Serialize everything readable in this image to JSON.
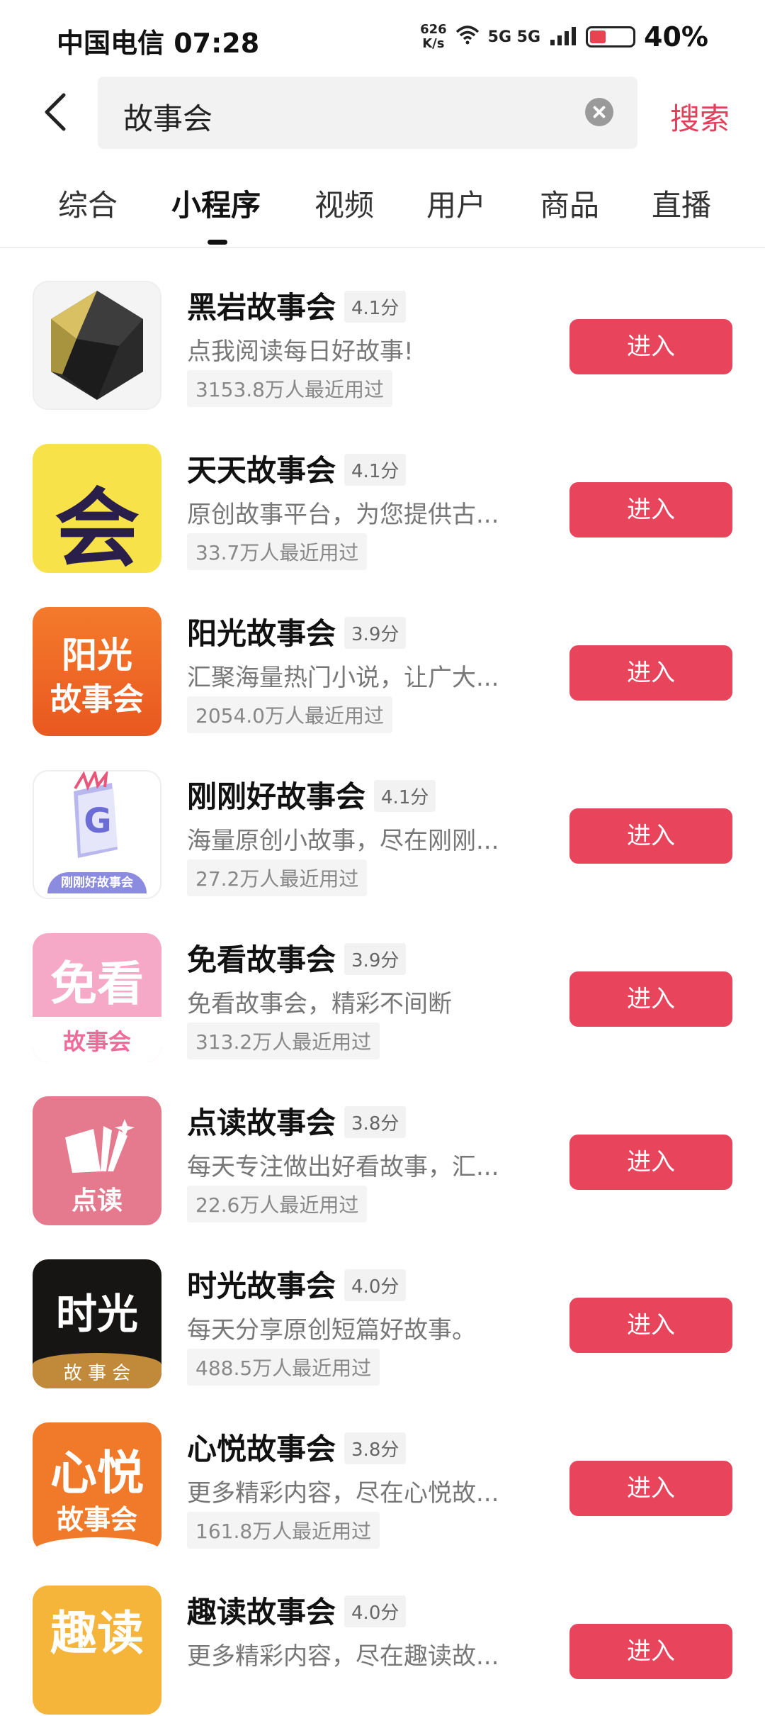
{
  "status": {
    "carrier_time": "中国电信 07:28",
    "net_speed": "626\nK/s",
    "signal": "5G 5G",
    "battery_level": 0.4,
    "battery_text": "40%"
  },
  "search": {
    "query": "故事会",
    "submit_label": "搜索"
  },
  "tabs": [
    {
      "label": "综合"
    },
    {
      "label": "小程序"
    },
    {
      "label": "视频"
    },
    {
      "label": "用户"
    },
    {
      "label": "商品"
    },
    {
      "label": "直播"
    }
  ],
  "active_tab": "小程序",
  "results": [
    {
      "name": "黑岩故事会",
      "score": "4.1分",
      "desc": "点我阅读每日好故事!",
      "users": "3153.8万人最近用过",
      "button": "进入"
    },
    {
      "name": "天天故事会",
      "score": "4.1分",
      "desc": "原创故事平台，为您提供古...",
      "users": "33.7万人最近用过",
      "button": "进入",
      "icon_text": "会"
    },
    {
      "name": "阳光故事会",
      "score": "3.9分",
      "desc": "汇聚海量热门小说，让广大...",
      "users": "2054.0万人最近用过",
      "button": "进入",
      "icon_text_1": "阳光",
      "icon_text_2": "故事会"
    },
    {
      "name": "刚刚好故事会",
      "score": "4.1分",
      "desc": "海量原创小故事，尽在刚刚...",
      "users": "27.2万人最近用过",
      "button": "进入",
      "icon_text": "刚刚好故事会"
    },
    {
      "name": "免看故事会",
      "score": "3.9分",
      "desc": "免看故事会，精彩不间断",
      "users": "313.2万人最近用过",
      "button": "进入",
      "icon_text_1": "免看",
      "icon_text_2": "故事会"
    },
    {
      "name": "点读故事会",
      "score": "3.8分",
      "desc": "每天专注做出好看故事，汇...",
      "users": "22.6万人最近用过",
      "button": "进入",
      "icon_text": "点读"
    },
    {
      "name": "时光故事会",
      "score": "4.0分",
      "desc": "每天分享原创短篇好故事。",
      "users": "488.5万人最近用过",
      "button": "进入",
      "icon_text_1": "时光",
      "icon_text_2": "故 事 会"
    },
    {
      "name": "心悦故事会",
      "score": "3.8分",
      "desc": "更多精彩内容，尽在心悦故...",
      "users": "161.8万人最近用过",
      "button": "进入",
      "icon_text_1": "心悦",
      "icon_text_2": "故事会"
    },
    {
      "name": "趣读故事会",
      "score": "4.0分",
      "desc": "更多精彩内容，尽在趣读故...",
      "users": "",
      "button": "进入",
      "icon_text_1": "趣读"
    }
  ]
}
